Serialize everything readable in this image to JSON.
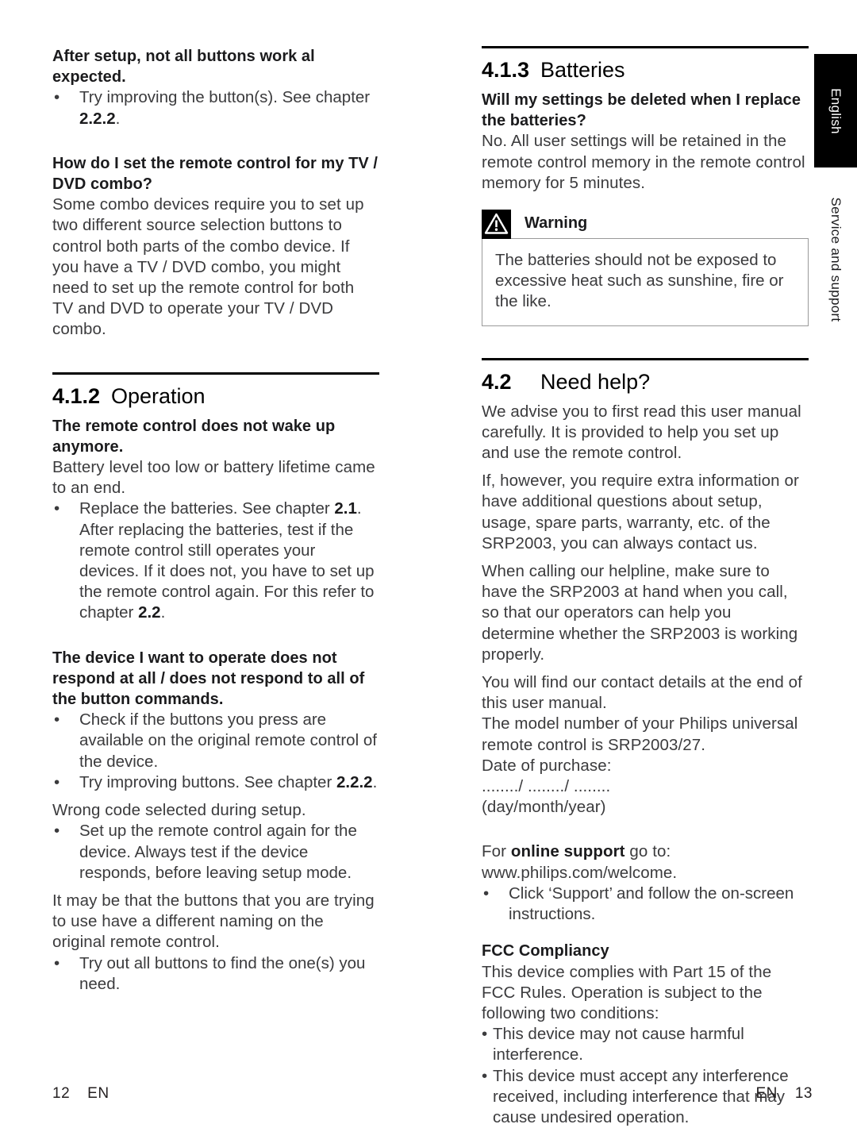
{
  "document": {
    "side_tab": {
      "language_tab": "English",
      "section_tab": "Service and support"
    },
    "footer_left": {
      "page": "12",
      "lang": "EN"
    },
    "footer_right": {
      "lang": "EN",
      "page": "13"
    }
  },
  "left_column": {
    "faq1": {
      "question": "After setup, not all buttons work al expected.",
      "bullet1_pre": "Try improving the button(s). See chapter ",
      "bullet1_bold": "2.2.2",
      "bullet1_post": "."
    },
    "faq2": {
      "question": "How do I set the remote control for my TV / DVD combo?",
      "answer": "Some combo devices require you to set up two different source selection buttons to control both parts of the combo device. If you have a TV / DVD combo, you might need to set up the remote control for both  TV and DVD to operate your TV / DVD combo."
    },
    "section_operation": {
      "number": "4.1.2",
      "title": "Operation"
    },
    "faq3": {
      "question": "The remote control does not wake up anymore.",
      "answer": "Battery level too low or battery lifetime came to an end.",
      "bullet1_pre": "Replace the batteries. See chapter ",
      "bullet1_bold1": "2.1",
      "bullet1_mid": ". After replacing the batteries, test if the remote control still operates your devices. If it does not, you have to set up the remote control again. For this refer to chapter ",
      "bullet1_bold2": "2.2",
      "bullet1_post": "."
    },
    "faq4": {
      "question": "The device I want to operate does not respond at all / does not respond to all of the button commands.",
      "bullet1": "Check if the buttons you press are available on the original remote control of the device.",
      "bullet2_pre": "Try improving buttons. See chapter ",
      "bullet2_bold": "2.2.2",
      "bullet2_post": ".",
      "para1": "Wrong code selected during setup.",
      "bullet3": "Set up the remote control again for the device. Always test if the device responds, before leaving setup mode.",
      "para2": "It may be that the buttons that you are trying to use have a different naming on the original remote control.",
      "bullet4": "Try out all buttons to find the one(s) you need."
    }
  },
  "right_column": {
    "section_batteries": {
      "number": "4.1.3",
      "title": "Batteries"
    },
    "faq5": {
      "question": "Will my settings be deleted when I replace the batteries?",
      "answer": "No. All user settings will be retained in the remote control memory in the remote control memory for 5 minutes."
    },
    "warning": {
      "icon": "warning-triangle-icon",
      "title": "Warning",
      "body": "The batteries should not be exposed to excessive heat such as sunshine, fire or the like."
    },
    "section_need_help": {
      "number": "4.2",
      "title": "Need help?"
    },
    "need_help": {
      "para1": "We advise you to first read this user manual carefully. It is provided to help you set up and use the remote control.",
      "para2": "If, however, you require extra information or have additional questions about setup, usage, spare parts, warranty, etc. of the SRP2003, you can always contact us.",
      "para3": "When calling our helpline, make sure to have the SRP2003 at hand when you call, so that our operators can help you determine whether the SRP2003 is working properly.",
      "para4": "You will find our contact details at the end of this user manual.",
      "para5": "The model number of your Philips universal remote control is SRP2003/27.",
      "date_label": "Date of purchase:",
      "date_blanks": "......../ ......../ ........",
      "date_format": "(day/month/year)",
      "online_pre": "For ",
      "online_bold": "online support",
      "online_post": " go to:",
      "website": "www.philips.com/welcome.",
      "bullet1": "Click ‘Support’ and follow the on-screen instructions."
    },
    "fcc": {
      "heading": "FCC Compliancy",
      "intro": "This device complies with Part 15 of the FCC Rules. Operation is subject to the following two conditions:",
      "bullet1": "This device may not cause harmful interference.",
      "bullet2": "This device must accept any interference received, including interference that may cause undesired operation."
    }
  },
  "colors": {
    "text": "#3b3b3d",
    "heading": "#1b1b1d",
    "rule": "#000000",
    "tab_background": "#000000",
    "tab_text": "#ffffff"
  }
}
